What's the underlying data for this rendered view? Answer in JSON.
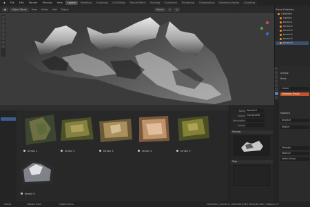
{
  "menubar": {
    "items": [
      "File",
      "Edit",
      "Render",
      "Window",
      "Help"
    ],
    "tabs": [
      "Layout",
      "Modeling",
      "Sculpting",
      "UV Editing",
      "Texture Paint",
      "Shading",
      "Animation",
      "Rendering",
      "Compositing",
      "Geometry Nodes",
      "Scripting"
    ],
    "active_tab": 0
  },
  "viewport_header": {
    "mode": "Object Mode",
    "items": [
      "View",
      "Select",
      "Add",
      "Object"
    ],
    "orientation": "Global"
  },
  "assets": [
    {
      "label": "terrain 1",
      "colors": [
        "#3a4630",
        "#7c7a4a",
        "#5a6a3c"
      ]
    },
    {
      "label": "terrain 2",
      "colors": [
        "#4e5228",
        "#8d8a45",
        "#b8a862"
      ]
    },
    {
      "label": "terrain 3",
      "colors": [
        "#6a5a38",
        "#b69a64",
        "#d8c898"
      ]
    },
    {
      "label": "terrain 4",
      "colors": [
        "#7a5a3a",
        "#c69a72",
        "#e8c8a8"
      ]
    },
    {
      "label": "terrain 5",
      "colors": [
        "#4a5024",
        "#8c8a3a",
        "#b6a85a"
      ]
    },
    {
      "label": "terrain 6",
      "colors": [
        "#2c2c30",
        "#8a8c94",
        "#e4e6ea"
      ]
    }
  ],
  "mid_panel": {
    "rows": [
      {
        "label": "Name",
        "value": "terrain 6"
      },
      {
        "label": "Source",
        "value": "Current File"
      },
      {
        "label": "Description",
        "value": ""
      },
      {
        "label": "Author",
        "value": ""
      }
    ],
    "preview_header": "Preview",
    "tags_header": "Tags"
  },
  "outliner": {
    "header": "Scene Collection",
    "rows": [
      {
        "label": "Collection",
        "selected": false
      },
      {
        "label": "Camera",
        "selected": false
      },
      {
        "label": "terrain 1",
        "selected": false
      },
      {
        "label": "terrain 2",
        "selected": false
      },
      {
        "label": "terrain 3",
        "selected": false
      },
      {
        "label": "terrain 4",
        "selected": false
      },
      {
        "label": "terrain 5",
        "selected": false
      },
      {
        "label": "terrain 6",
        "selected": true
      }
    ]
  },
  "properties": {
    "rows": [
      {
        "label": "Sample",
        "kind": "plain"
      },
      {
        "label": "Noise",
        "kind": "plain"
      },
      {
        "label": "Create",
        "kind": "field"
      },
      {
        "label": "Generate Terrain",
        "kind": "accent"
      },
      {
        "label": "Modifiers",
        "kind": "plain"
      },
      {
        "label": "Displace",
        "kind": "field"
      },
      {
        "label": "Texture",
        "kind": "field"
      },
      {
        "label": "Strength",
        "kind": "field"
      },
      {
        "label": "Midlevel",
        "kind": "field"
      },
      {
        "label": "Vertex Group",
        "kind": "field"
      }
    ]
  },
  "status": {
    "left": "Select",
    "middle": "Rotate View",
    "right": "Object Menu",
    "stats": "Collection | terrain 6 | Verts 65,536 | Faces 65,025 | Objects 1/7"
  }
}
